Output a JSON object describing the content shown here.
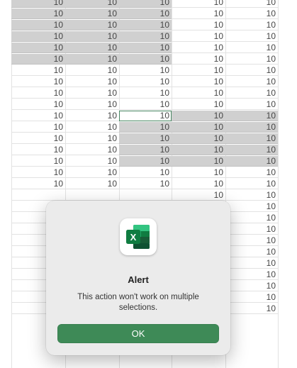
{
  "sheet": {
    "cell_value": "10",
    "row_count": 28,
    "visible_value_rows": [
      17,
      17,
      17,
      28,
      28
    ],
    "dialog_overlap_rows": {
      "first_hidden_row": 17,
      "partial_row": 16
    },
    "selections": [
      {
        "col_start": 0,
        "col_end": 2,
        "row_start": 0,
        "row_end": 5
      },
      {
        "col_start": 2,
        "col_end": 4,
        "row_start": 10,
        "row_end": 14
      }
    ],
    "active_cell": {
      "col": 2,
      "row": 10
    },
    "colors": {
      "selection": "#c6c6c6",
      "gridline": "#dcdcdc",
      "active_border": "#1e6b3e"
    }
  },
  "dialog": {
    "title": "Alert",
    "message": "This action won't work on multiple selections.",
    "ok_label": "OK",
    "icon": "excel-icon",
    "colors": {
      "button": "#3e8a57",
      "background": "#ebebeb"
    }
  }
}
